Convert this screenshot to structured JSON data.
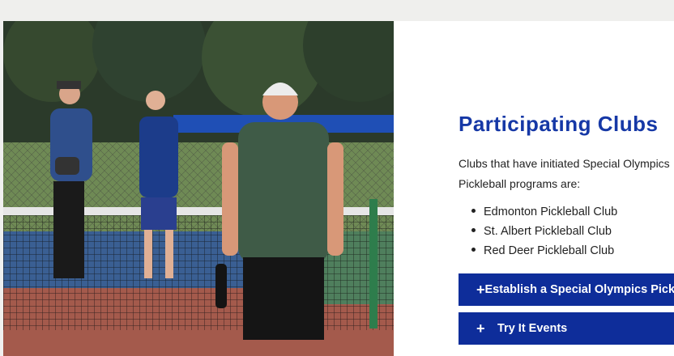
{
  "photo": {
    "alt_semantic": "pickleball-players-photo"
  },
  "section": {
    "title": "Participating Clubs",
    "intro": "Clubs that have initiated Special Olympics Pickleball programs are:",
    "clubs": [
      "Edmonton Pickleball Club",
      "St. Albert Pickleball Club",
      "Red Deer Pickleball Club"
    ]
  },
  "accordion": [
    {
      "label": "Establish a Special Olympics Pickleball Program",
      "icon": "plus-icon"
    },
    {
      "label": "Try It Events",
      "icon": "plus-icon"
    }
  ],
  "colors": {
    "accent": "#1638a6",
    "button": "#0e2d9a"
  }
}
